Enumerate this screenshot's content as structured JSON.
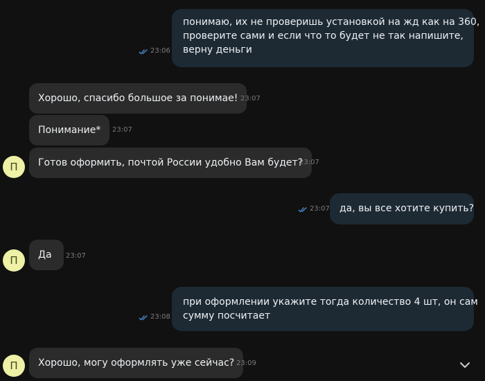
{
  "colors": {
    "background": "#111111",
    "incoming_bubble": "#2b2b2b",
    "outgoing_bubble": "#1d2a34",
    "avatar": "#eef1a6",
    "read_check": "#4e8fd6"
  },
  "contact": {
    "avatar_letter": "П"
  },
  "messages": [
    {
      "direction": "out",
      "lines": [
        "понимаю, их не проверишь установкой на жд как на 360,",
        "проверите сами и если что то будет не так напишите,",
        "верну деньги"
      ],
      "time": "23:06",
      "status_icon": "double-check-icon"
    },
    {
      "direction": "in",
      "text": "Хорошо, спасибо большое за понимае!",
      "time": "23:07"
    },
    {
      "direction": "in",
      "text": "Понимание*",
      "time": "23:07"
    },
    {
      "direction": "in",
      "text": "Готов оформить, почтой России удобно Вам будет?",
      "time": "23:07"
    },
    {
      "direction": "out",
      "text": "да, вы все хотите купить?",
      "time": "23:07",
      "status_icon": "double-check-icon"
    },
    {
      "direction": "in",
      "text": "Да",
      "time": "23:07"
    },
    {
      "direction": "out",
      "lines": [
        "при оформлении укажите тогда количество 4 шт, он сам",
        "сумму посчитает"
      ],
      "time": "23:08",
      "status_icon": "double-check-icon"
    },
    {
      "direction": "in",
      "text": "Хорошо, могу оформлять уже сейчас?",
      "time": "23:09"
    }
  ],
  "scroll_button": {
    "icon": "chevron-down-icon"
  }
}
